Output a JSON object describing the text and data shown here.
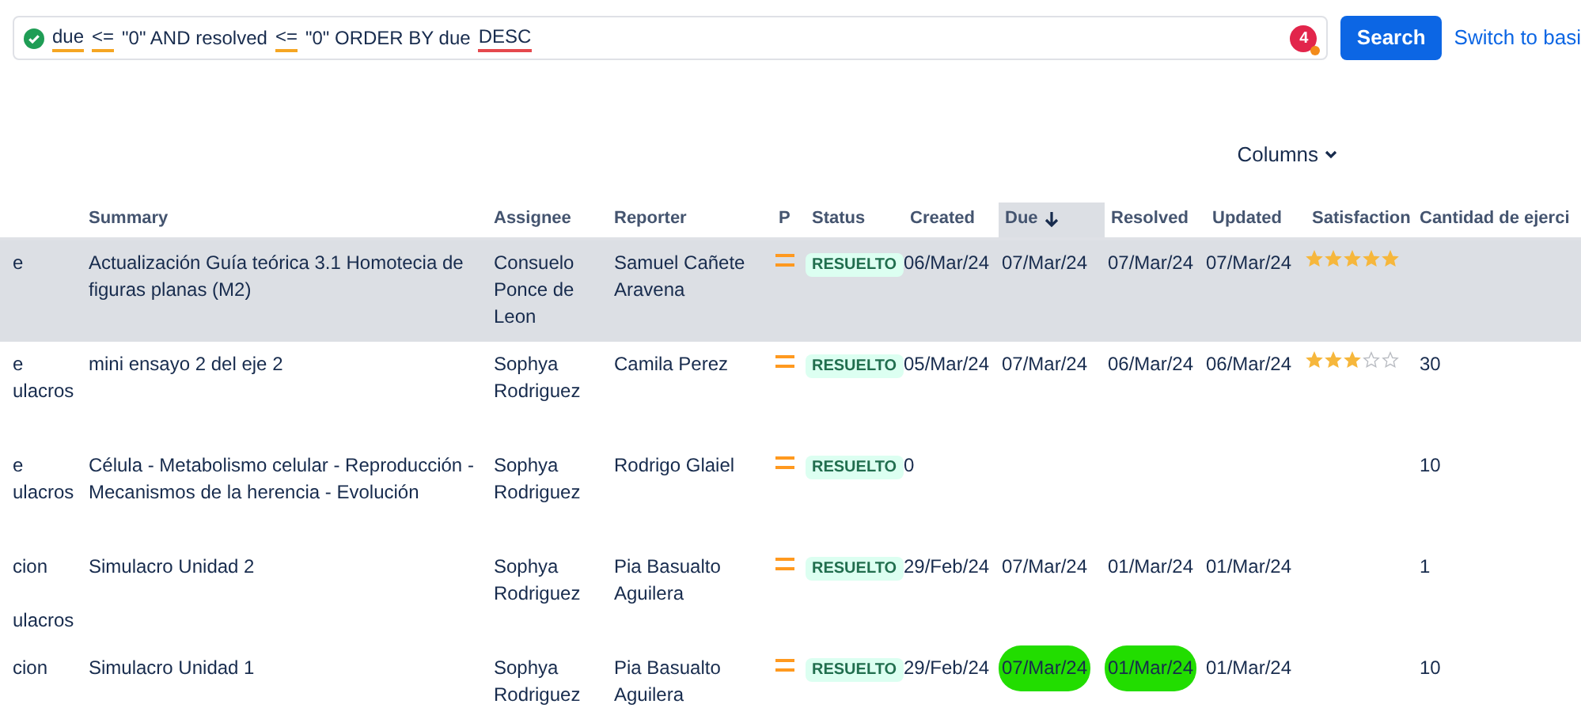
{
  "query": {
    "tokens": [
      {
        "text": "due",
        "kind": "warning"
      },
      {
        "text": "<=",
        "kind": "warning"
      },
      {
        "text": "\"0\" AND resolved",
        "kind": "plain"
      },
      {
        "text": "<=",
        "kind": "warning"
      },
      {
        "text": "\"0\" ORDER BY due",
        "kind": "plain"
      },
      {
        "text": "DESC",
        "kind": "error"
      }
    ],
    "valid": true,
    "badge": "4"
  },
  "search_button": "Search",
  "switch_link": "Switch to basi",
  "columns_button": "Columns",
  "table": {
    "columns": [
      {
        "sorted": false
      },
      {
        "label": "Summary",
        "sorted": false
      },
      {
        "label": "Assignee",
        "sorted": false
      },
      {
        "label": "Reporter",
        "sorted": false
      },
      {
        "label": "P",
        "sorted": false
      },
      {
        "label": "Status",
        "sorted": false
      },
      {
        "label": "Created",
        "sorted": false
      },
      {
        "label": "Due",
        "sorted": true
      },
      {
        "label": "Resolved",
        "sorted": false
      },
      {
        "label": "Updated",
        "sorted": false
      },
      {
        "label": "Satisfaction",
        "sorted": false
      },
      {
        "label": "Cantidad de ejerci",
        "sorted": false
      }
    ],
    "rows": [
      {
        "selected": true,
        "column_1": [
          "e"
        ],
        "summary": "Actualización Guía teórica 3.1 Homotecia de figuras planas (M2)",
        "assignee": "Consuelo Ponce de Leon",
        "reporter": "Samuel Cañete Aravena",
        "status": "RESUELTO",
        "created": "06/Mar/24",
        "due": {
          "text": "07/Mar/24",
          "marked": false
        },
        "resolved": {
          "text": "07/Mar/24",
          "marked": false
        },
        "updated": "07/Mar/24",
        "stars": 5
      },
      {
        "selected": false,
        "column_1": [
          "e",
          "ulacros"
        ],
        "summary": "mini ensayo 2 del eje 2",
        "assignee": "Sophya Rodriguez",
        "reporter": "Camila Perez",
        "status": "RESUELTO",
        "created": "05/Mar/24",
        "due": {
          "text": "07/Mar/24",
          "marked": false
        },
        "resolved": {
          "text": "06/Mar/24",
          "marked": false
        },
        "updated": "06/Mar/24",
        "stars": 3,
        "cantidad": "30"
      },
      {
        "selected": false,
        "column_1": [
          "e",
          "ulacros"
        ],
        "summary": "Célula - Metabolismo celular - Reproducción - Mecanismos de la herencia - Evolución",
        "assignee": "Sophya Rodriguez",
        "reporter": "Rodrigo Glaiel",
        "status": "RESUELTO",
        "created": "0",
        "cantidad": "10"
      },
      {
        "selected": false,
        "column_1": [
          "cion"
        ],
        "column_1_below": "ulacros",
        "summary": "Simulacro Unidad 2",
        "assignee": "Sophya Rodriguez",
        "reporter": "Pia Basualto Aguilera",
        "status": "RESUELTO",
        "created": "29/Feb/24",
        "due": {
          "text": "07/Mar/24",
          "marked": false
        },
        "resolved": {
          "text": "01/Mar/24",
          "marked": false
        },
        "updated": "01/Mar/24",
        "cantidad": "1"
      },
      {
        "selected": false,
        "column_1": [
          "cion"
        ],
        "summary": "Simulacro Unidad 1",
        "assignee": "Sophya Rodriguez",
        "reporter": "Pia Basualto Aguilera",
        "status": "RESUELTO",
        "created": "29/Feb/24",
        "due": {
          "text": "07/Mar/24",
          "marked": true
        },
        "resolved": {
          "text": "01/Mar/24",
          "marked": true
        },
        "updated": "01/Mar/24",
        "cantidad": "10"
      }
    ]
  }
}
